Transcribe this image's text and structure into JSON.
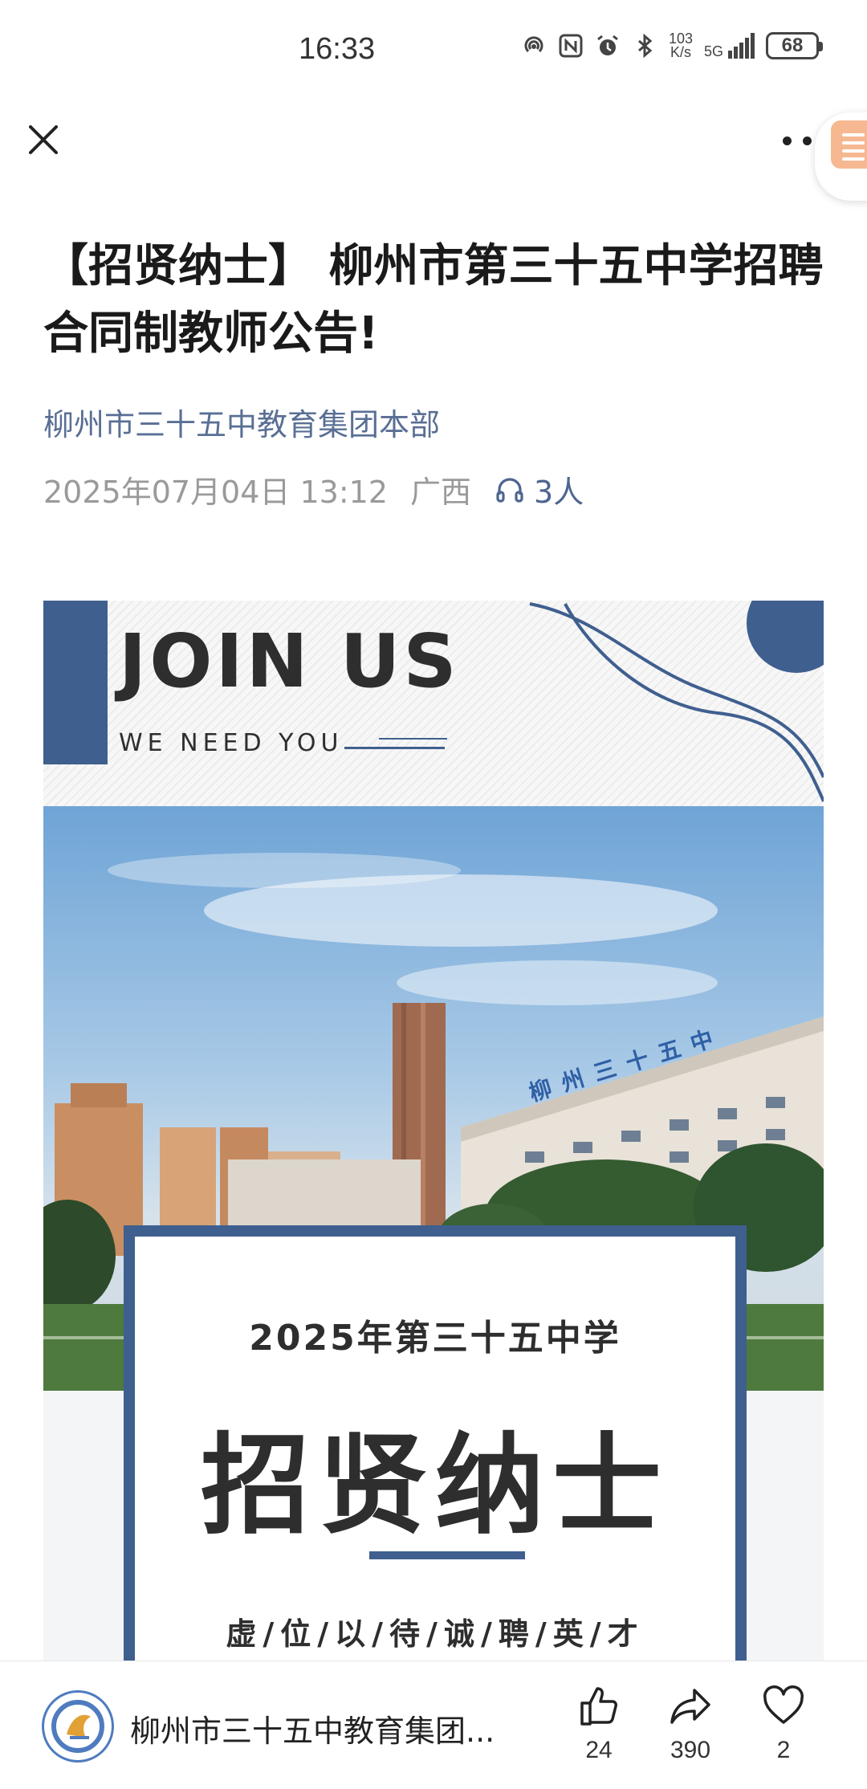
{
  "status_bar": {
    "time": "16:33",
    "net_speed_value": "103",
    "net_speed_unit": "K/s",
    "network": "5G",
    "battery": "68",
    "icons": [
      "hotspot-icon",
      "nfc-icon",
      "alarm-icon",
      "bluetooth-icon",
      "signal-icon",
      "battery-icon"
    ]
  },
  "nav": {
    "close_icon": "close-icon",
    "more_icon": "more-icon"
  },
  "article": {
    "title": "【招贤纳士】 柳州市第三十五中学招聘合同制教师公告!",
    "author": "柳州市三十五中教育集团本部",
    "datetime": "2025年07月04日 13:12",
    "location": "广西",
    "listeners": "3人"
  },
  "poster": {
    "headline": "JOIN US",
    "tagline": "WE NEED YOU",
    "building_sign": "柳州三十五中",
    "card_subtitle": "2025年第三十五中学",
    "card_title": "招贤纳士",
    "card_slogan": "虚/位/以/待/诚/聘/英/才",
    "accent_color": "#3f5f8f"
  },
  "bottom_bar": {
    "account_name": "柳州市三十五中教育集团...",
    "likes": "24",
    "shares": "390",
    "favorites": "2"
  }
}
